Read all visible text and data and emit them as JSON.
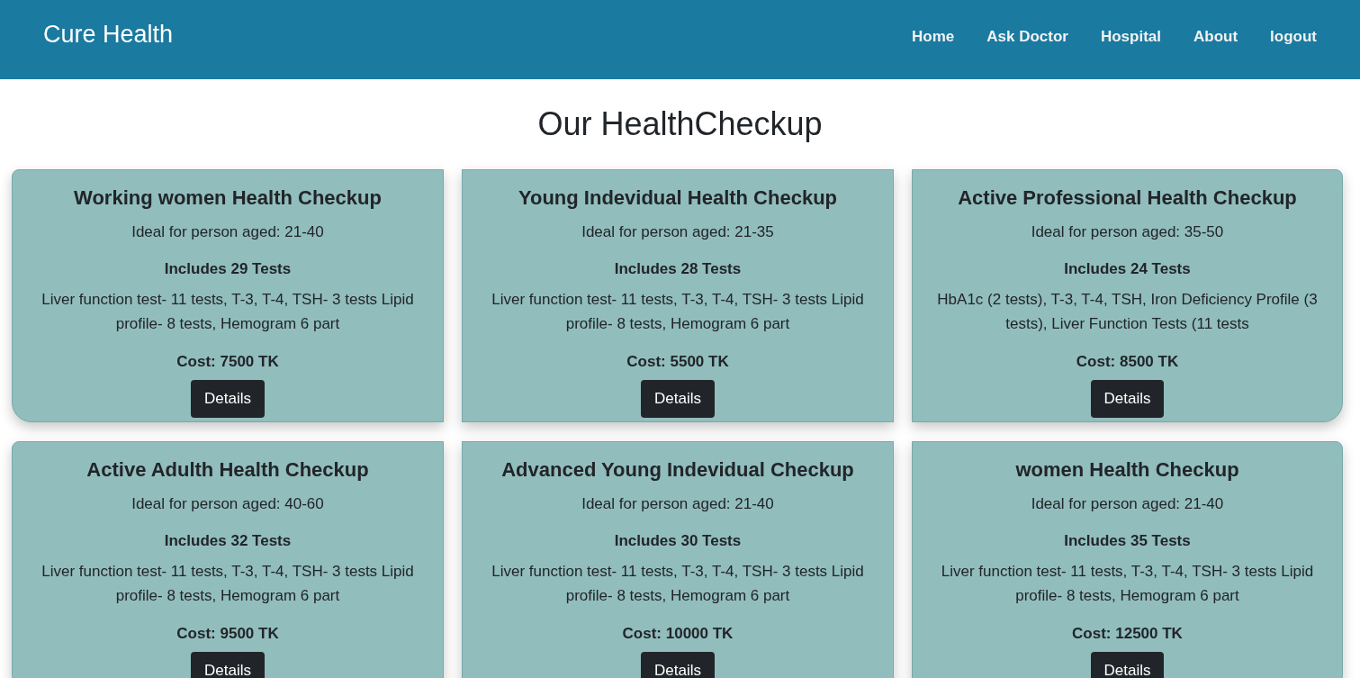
{
  "header": {
    "brand": "Cure Health",
    "nav": [
      {
        "label": "Home"
      },
      {
        "label": "Ask Doctor"
      },
      {
        "label": "Hospital"
      },
      {
        "label": "About"
      },
      {
        "label": "logout"
      }
    ]
  },
  "heading": "Our HealthCheckup",
  "packages": [
    {
      "title": "Working women Health Checkup",
      "age": "Ideal for person aged: 21-40",
      "tests": "Includes 29 Tests",
      "description": "Liver function test- 11 tests, T-3, T-4, TSH- 3 tests Lipid profile- 8 tests, Hemogram 6 part",
      "cost": "Cost: 7500 TK",
      "button": "Details"
    },
    {
      "title": "Young Indevidual Health Checkup",
      "age": "Ideal for person aged: 21-35",
      "tests": "Includes 28 Tests",
      "description": "Liver function test- 11 tests, T-3, T-4, TSH- 3 tests Lipid profile- 8 tests, Hemogram 6 part",
      "cost": "Cost: 5500 TK",
      "button": "Details"
    },
    {
      "title": "Active Professional Health Checkup",
      "age": "Ideal for person aged: 35-50",
      "tests": "Includes 24 Tests",
      "description": "HbA1c (2 tests), T-3, T-4, TSH, Iron Deficiency Profile (3 tests), Liver Function Tests (11 tests",
      "cost": "Cost: 8500 TK",
      "button": "Details"
    },
    {
      "title": "Active Adulth Health Checkup",
      "age": "Ideal for person aged: 40-60",
      "tests": "Includes 32 Tests",
      "description": "Liver function test- 11 tests, T-3, T-4, TSH- 3 tests Lipid profile- 8 tests, Hemogram 6 part",
      "cost": "Cost: 9500 TK",
      "button": "Details"
    },
    {
      "title": "Advanced Young Indevidual Checkup",
      "age": "Ideal for person aged: 21-40",
      "tests": "Includes 30 Tests",
      "description": "Liver function test- 11 tests, T-3, T-4, TSH- 3 tests Lipid profile- 8 tests, Hemogram 6 part",
      "cost": "Cost: 10000 TK",
      "button": "Details"
    },
    {
      "title": "women Health Checkup",
      "age": "Ideal for person aged: 21-40",
      "tests": "Includes 35 Tests",
      "description": "Liver function test- 11 tests, T-3, T-4, TSH- 3 tests Lipid profile- 8 tests, Hemogram 6 part",
      "cost": "Cost: 12500 TK",
      "button": "Details"
    }
  ]
}
